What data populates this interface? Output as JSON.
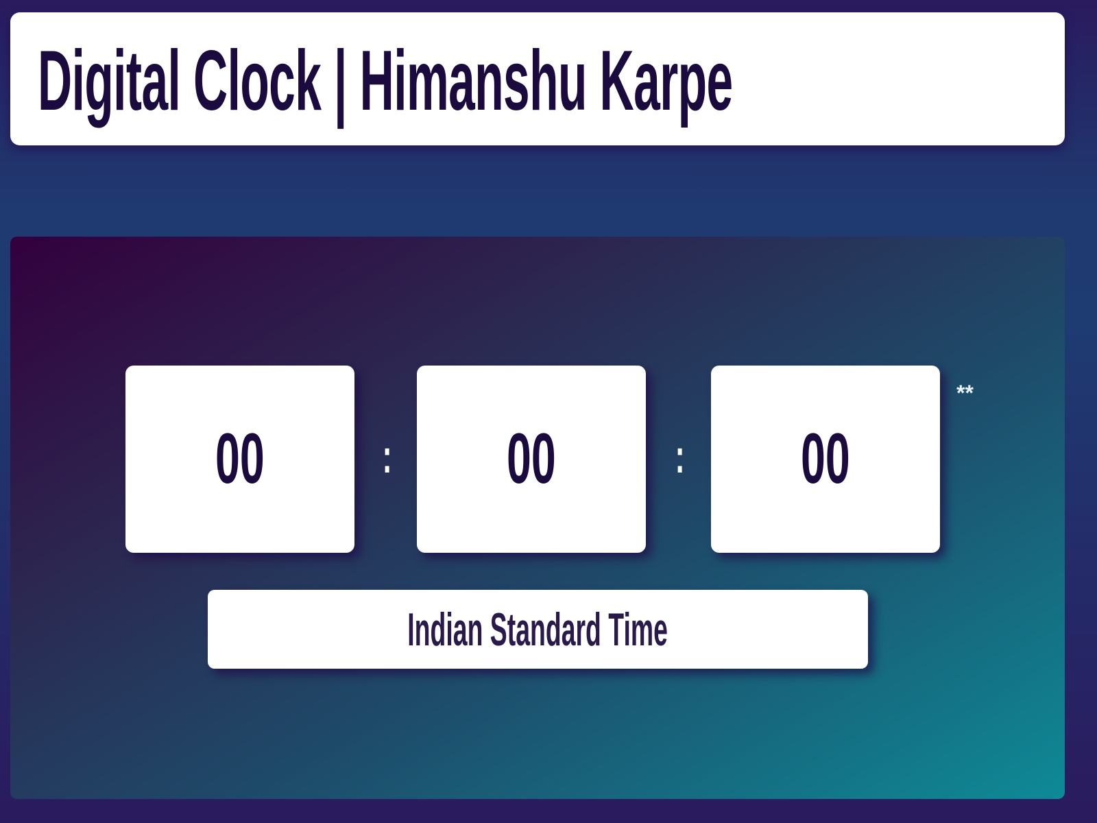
{
  "header": {
    "title": "Digital Clock | Himanshu Karpe"
  },
  "clock": {
    "hours": "00",
    "minutes": "00",
    "seconds": "00",
    "separator": ":",
    "period": "**",
    "timezone": "Indian Standard Time"
  },
  "colors": {
    "text": "#1a0a3d",
    "gradient_start": "#33003d",
    "gradient_end": "#0e8a96"
  }
}
